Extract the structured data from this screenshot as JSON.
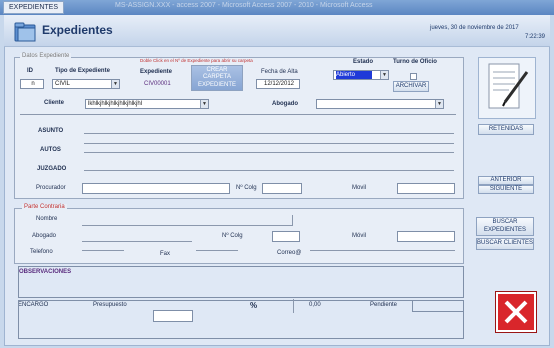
{
  "window": {
    "tab_label": "EXPEDIENTES",
    "title_faded": "MS-ASSIGN.XXX - access 2007 - Microsoft Access 2007 - 2010 - Microsoft Access"
  },
  "header": {
    "title": "Expedientes",
    "date": "jueves, 30 de noviembre de 2017",
    "time": "7:22:39"
  },
  "datos": {
    "legend": "Datos Expediente",
    "hint": "Doble Click en el Nº de Expediente para abrir su carpeta",
    "id_label": "ID",
    "id_value": "n",
    "tipo_label": "Tipo de Expediente",
    "tipo_value": "CIVIL",
    "exp_label": "Expediente",
    "exp_value": "CIV00001",
    "crear_button": "CREAR CARPETA EXPEDIENTE",
    "fecha_label": "Fecha de Alta",
    "fecha_value": "12/12/2012",
    "estado_label": "Estado",
    "estado_value": "Abierto",
    "turno_label": "Turno de Oficio",
    "archivar_button": "ARCHIVAR",
    "cliente_label": "Cliente",
    "cliente_value": "lkhlkjhlkjhlkjhlkjhlkjhl",
    "abogado_label": "Abogado",
    "asunto_label": "ASUNTO",
    "autos_label": "AUTOS",
    "juzgado_label": "JUZGADO",
    "procurador_label": "Procurador",
    "ncolg_label": "Nº Colg",
    "movil_label": "Movil"
  },
  "contraria": {
    "legend": "Parte Contraria",
    "nombre_label": "Nombre",
    "abogado_label": "Abogado",
    "ncolg_label": "Nº Colg",
    "movil_label": "Móvil",
    "telefono_label": "Telefono",
    "fax_label": "Fax",
    "correo_label": "Correo@"
  },
  "observaciones_label": "OBSERVACIONES",
  "encargo": {
    "label": "ENCARGO",
    "presupuesto_label": "Presupuesto",
    "percent": "%",
    "amount": "0,00",
    "pendiente_label": "Pendiente"
  },
  "right_buttons": {
    "retenidas": "RETENIDAS",
    "anterior": "ANTERIOR",
    "siguiente": "SIGUIENTE",
    "buscar_expedientes": "BUSCAR EXPEDIENTES",
    "buscar_clientes": "BUSCAR CLIENTES"
  },
  "colors": {
    "title": "#1f3a6b",
    "close": "#d9262b",
    "estado_bg": "#1f3ad8"
  },
  "icons": [
    "folder-icon",
    "notes-icon",
    "close-icon",
    "chevron-down-icon"
  ]
}
